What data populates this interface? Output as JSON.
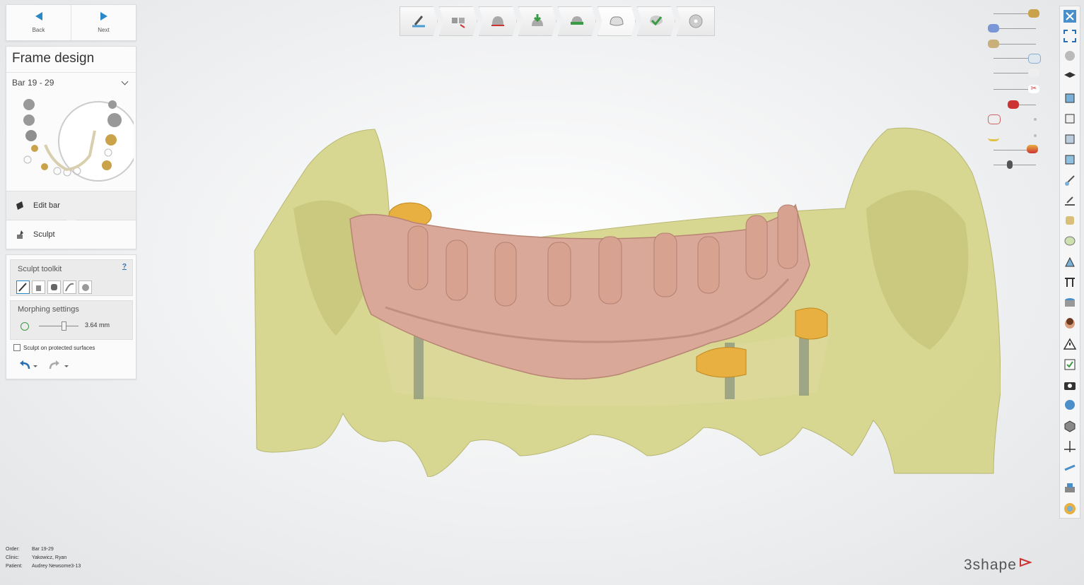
{
  "nav": {
    "back_label": "Back",
    "next_label": "Next"
  },
  "frame": {
    "title": "Frame design",
    "selected_bar": "Bar 19 - 29",
    "steps": [
      {
        "label": "Edit bar"
      },
      {
        "label": "Sculpt"
      }
    ]
  },
  "toolkit": {
    "title": "Sculpt toolkit",
    "help": "?",
    "morph_title": "Morphing settings",
    "morph_value": "3.64 mm",
    "morph_level": 0.55,
    "checkbox_label": "Sculpt on protected surfaces",
    "checkbox_checked": false
  },
  "topbar": {
    "steps": [
      "scan-icon",
      "implant-icon",
      "margin-icon",
      "insertion-icon",
      "prep-icon",
      "frame-icon",
      "check-icon",
      "output-icon"
    ],
    "active_index": 5
  },
  "info": {
    "order_label": "Order:",
    "order_value": "Bar 19-29",
    "clinic_label": "Clinic:",
    "clinic_value": "Yakowicz, Ryan",
    "patient_label": "Patient:",
    "patient_value": "Audrey Newsome3-13"
  },
  "logo": {
    "text": "3shape"
  },
  "colors": {
    "accent": "#2b88c8",
    "model": "#d9d98a",
    "bar": "#d9a899",
    "gold": "#e8b040"
  }
}
